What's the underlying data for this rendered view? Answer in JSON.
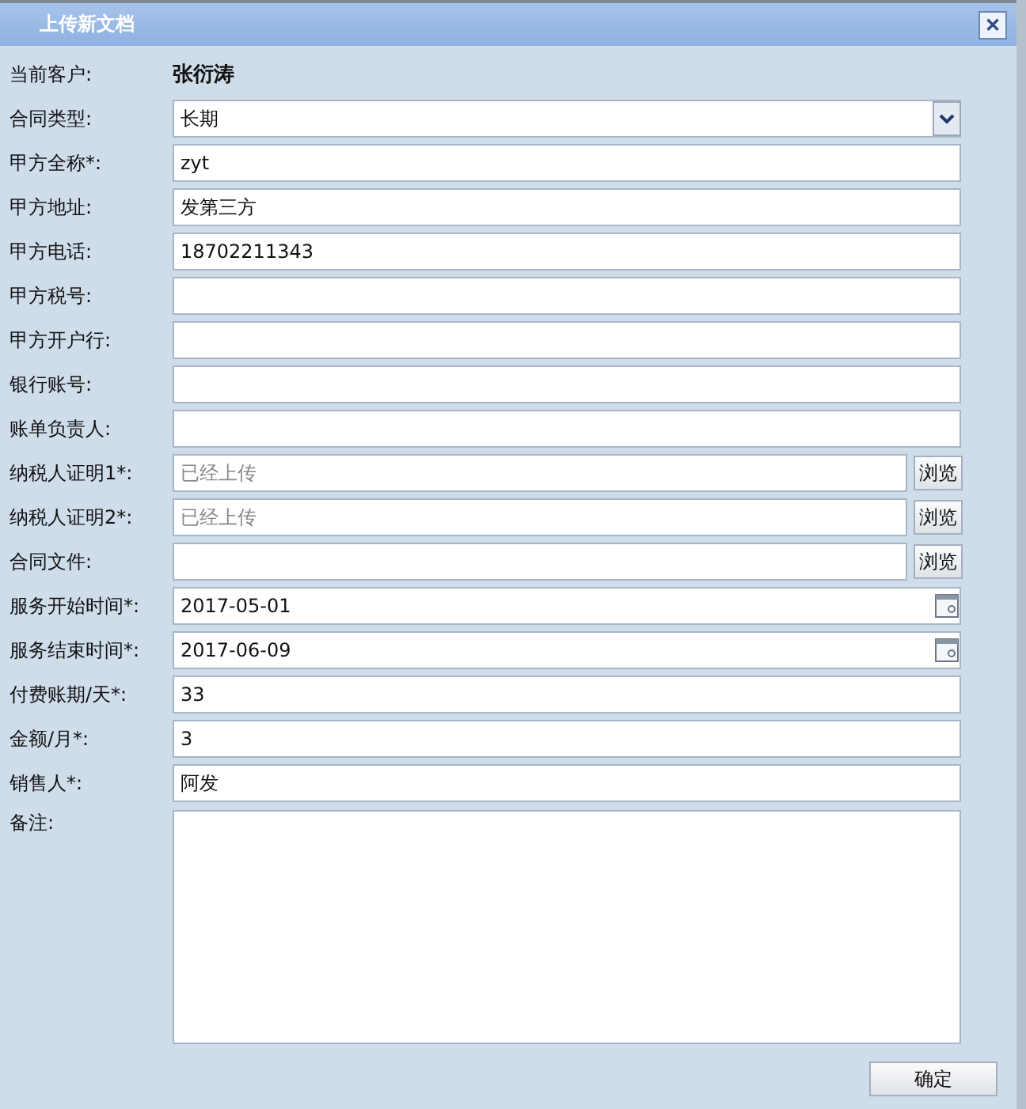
{
  "window": {
    "title": "上传新文档",
    "close": "✕"
  },
  "fields": [
    {
      "kind": "static",
      "label": "当前客户:",
      "value": "张衍涛"
    },
    {
      "kind": "select",
      "label": "合同类型:",
      "value": "长期"
    },
    {
      "kind": "text",
      "label": "甲方全称*:",
      "value": "zyt"
    },
    {
      "kind": "text",
      "label": "甲方地址:",
      "value": "发第三方"
    },
    {
      "kind": "text",
      "label": "甲方电话:",
      "value": "18702211343"
    },
    {
      "kind": "text",
      "label": "甲方税号:"
    },
    {
      "kind": "text",
      "label": "甲方开户行:"
    },
    {
      "kind": "text",
      "label": "银行账号:"
    },
    {
      "kind": "text",
      "label": "账单负责人:"
    },
    {
      "kind": "file",
      "label": "纳税人证明1*:",
      "placeholder": "已经上传",
      "button": "浏览"
    },
    {
      "kind": "file",
      "label": "纳税人证明2*:",
      "placeholder": "已经上传",
      "button": "浏览"
    },
    {
      "kind": "file",
      "label": "合同文件:",
      "button": "浏览"
    },
    {
      "kind": "date",
      "label": "服务开始时间*:",
      "value": "2017-05-01"
    },
    {
      "kind": "date",
      "label": "服务结束时间*:",
      "value": "2017-06-09"
    },
    {
      "kind": "text",
      "label": "付费账期/天*:",
      "value": "33"
    },
    {
      "kind": "text",
      "label": "金额/月*:",
      "value": "3"
    },
    {
      "kind": "text",
      "label": "销售人*:",
      "value": "阿发"
    },
    {
      "kind": "textarea",
      "label": "备注:"
    }
  ],
  "submit": "确定"
}
